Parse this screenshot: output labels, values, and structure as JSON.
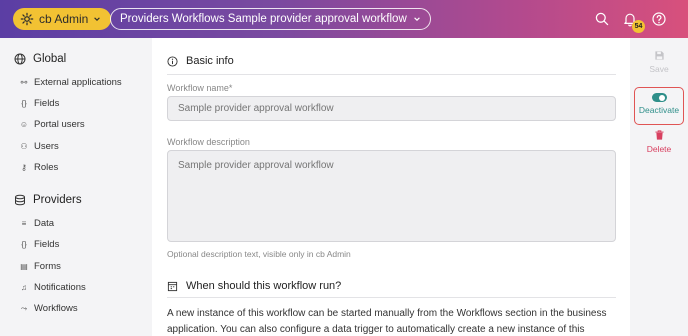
{
  "header": {
    "app_label": "cb Admin",
    "breadcrumb": "Providers Workflows Sample provider approval workflow",
    "notifications_count": "54"
  },
  "sidebar": {
    "global": {
      "title": "Global",
      "items": [
        {
          "label": "External applications",
          "icon": "plug-icon"
        },
        {
          "label": "Fields",
          "icon": "braces-icon"
        },
        {
          "label": "Portal users",
          "icon": "portal-users-icon"
        },
        {
          "label": "Users",
          "icon": "users-icon"
        },
        {
          "label": "Roles",
          "icon": "key-icon"
        }
      ]
    },
    "providers": {
      "title": "Providers",
      "items": [
        {
          "label": "Data",
          "icon": "database-icon"
        },
        {
          "label": "Fields",
          "icon": "braces-icon"
        },
        {
          "label": "Forms",
          "icon": "form-icon"
        },
        {
          "label": "Notifications",
          "icon": "bell-icon"
        },
        {
          "label": "Workflows",
          "icon": "workflow-icon"
        }
      ]
    }
  },
  "main": {
    "basic_info_title": "Basic info",
    "workflow_name_label": "Workflow name",
    "workflow_name_required": "*",
    "workflow_name_placeholder": "Sample provider approval workflow",
    "workflow_description_label": "Workflow description",
    "workflow_description_placeholder": "Sample provider approval workflow",
    "description_help": "Optional description text, visible only in cb Admin",
    "when_run_title": "When should this workflow run?",
    "when_run_text": "A new instance of this workflow can be started manually from the Workflows section in the business application. You can also configure a data trigger to automatically create a new instance of this"
  },
  "actions": {
    "save_label": "Save",
    "deactivate_label": "Deactivate",
    "delete_label": "Delete"
  },
  "colors": {
    "accent_yellow": "#f2c233",
    "deactivate_teal": "#2f8f8a",
    "delete_red": "#d84060"
  }
}
